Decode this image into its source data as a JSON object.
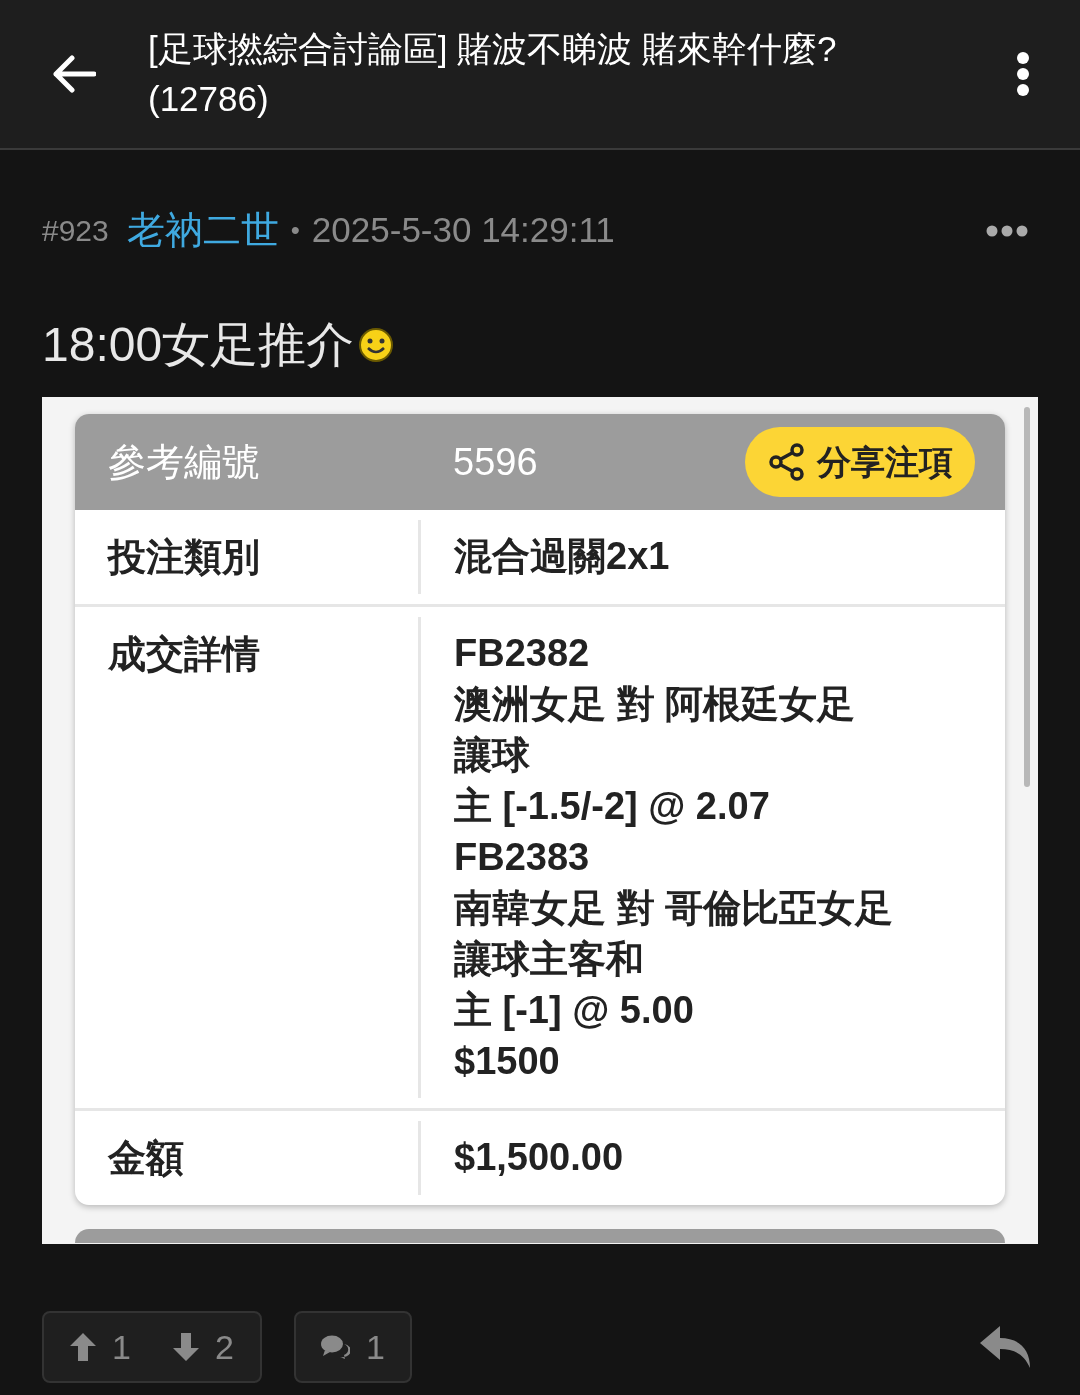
{
  "header": {
    "title": "[足球撚綜合討論區] 賭波不睇波 賭來幹什麼? (12786)"
  },
  "post": {
    "number": "#923",
    "author": "老衲二世",
    "separator": "•",
    "time": "2025-5-30 14:29:11",
    "text": "18:00女足推介",
    "slip": {
      "reference_label": "參考編號",
      "reference": "5596",
      "share_button": "分享注項",
      "rows": [
        {
          "label": "投注類別",
          "lines": [
            "混合過關2x1"
          ]
        },
        {
          "label": "成交詳情",
          "lines": [
            "FB2382",
            "澳洲女足 對 阿根廷女足",
            "讓球",
            "主 [-1.5/-2] @ 2.07",
            "FB2383",
            "南韓女足 對 哥倫比亞女足",
            "讓球主客和",
            "主 [-1] @ 5.00",
            "$1500"
          ]
        },
        {
          "label": "金額",
          "lines": [
            "$1,500.00"
          ]
        }
      ]
    }
  },
  "actions": {
    "upvotes": "1",
    "downvotes": "2",
    "comments": "1"
  }
}
